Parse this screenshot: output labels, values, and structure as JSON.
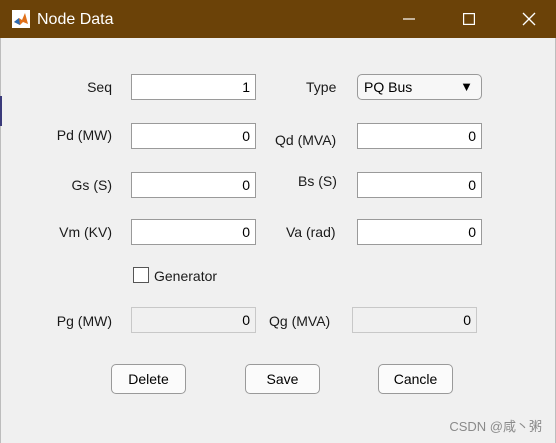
{
  "window": {
    "title": "Node Data",
    "minimize_icon": "minimize-icon",
    "maximize_icon": "maximize-icon",
    "close_icon": "close-icon",
    "titlebar_color": "#6b4208"
  },
  "form": {
    "seq": {
      "label": "Seq",
      "value": "1"
    },
    "type": {
      "label": "Type",
      "value": "PQ Bus"
    },
    "pd": {
      "label": "Pd (MW)",
      "value": "0"
    },
    "qd": {
      "label": "Qd (MVA)",
      "value": "0"
    },
    "gs": {
      "label": "Gs (S)",
      "value": "0"
    },
    "bs": {
      "label": "Bs (S)",
      "value": "0"
    },
    "vm": {
      "label": "Vm (KV)",
      "value": "0"
    },
    "va": {
      "label": "Va (rad)",
      "value": "0"
    },
    "generator": {
      "label": "Generator",
      "checked": false
    },
    "pg": {
      "label": "Pg (MW)",
      "value": "0"
    },
    "qg": {
      "label": "Qg (MVA)",
      "value": "0"
    }
  },
  "buttons": {
    "delete": "Delete",
    "save": "Save",
    "cancel": "Cancle"
  },
  "watermark": "CSDN @咸丶粥"
}
